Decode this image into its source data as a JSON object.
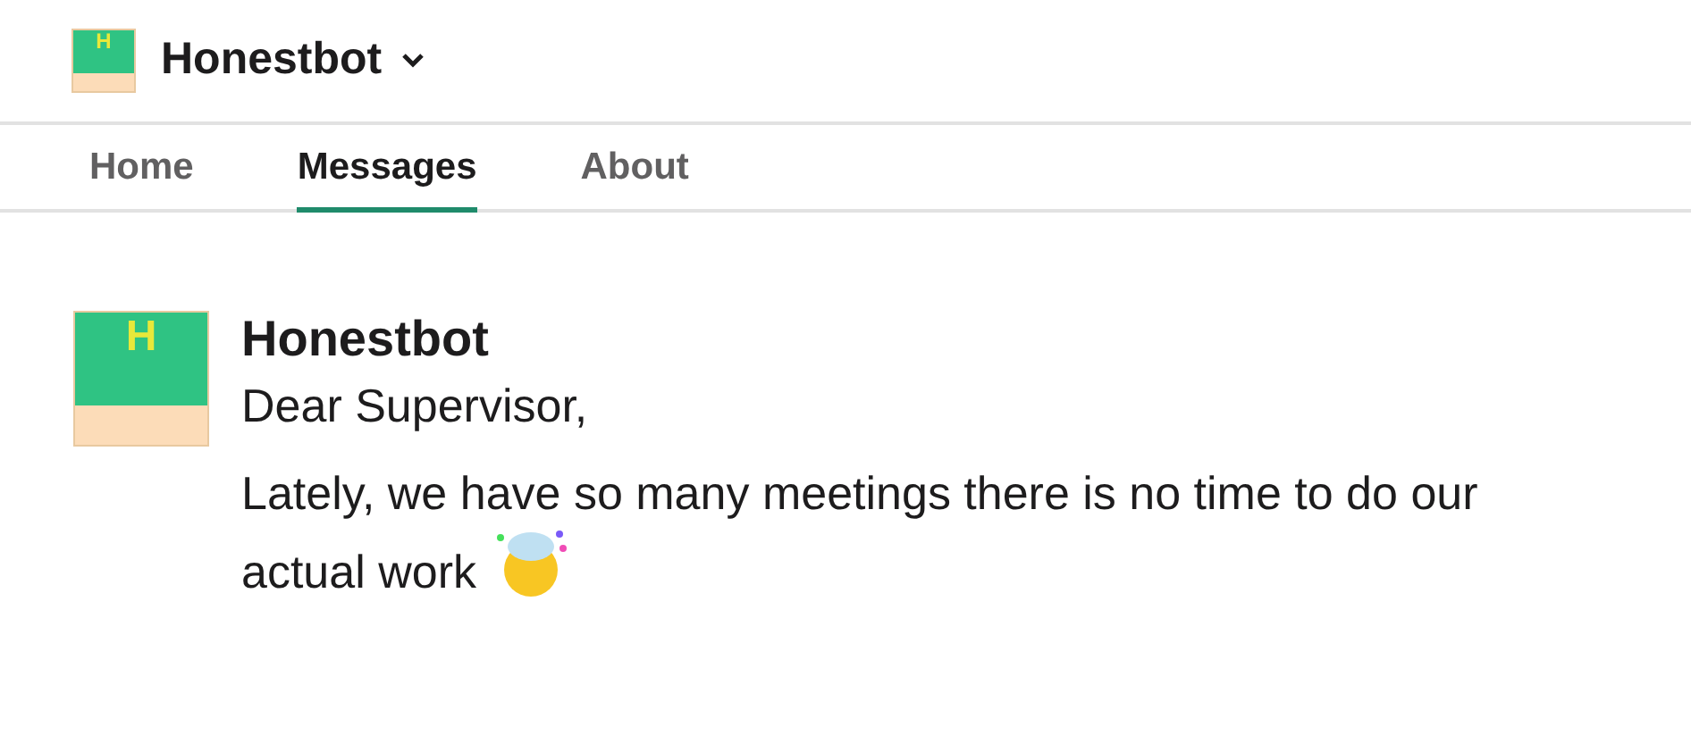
{
  "app": {
    "name": "Honestbot",
    "logo_letter": "H"
  },
  "tabs": [
    {
      "label": "Home",
      "selected": false
    },
    {
      "label": "Messages",
      "selected": true
    },
    {
      "label": "About",
      "selected": false
    }
  ],
  "message": {
    "avatar_letter": "H",
    "sender": "Honestbot",
    "lines": [
      "Dear Supervisor,",
      "Lately, we have so many meetings there is no time to do our actual work"
    ]
  }
}
